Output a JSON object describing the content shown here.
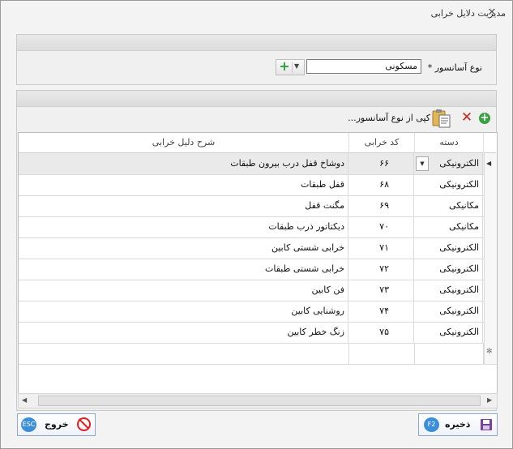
{
  "window": {
    "title": "مدیریت دلایل خرابی",
    "close_glyph": "✕"
  },
  "filter": {
    "label": "نوع آسانسور *",
    "selected_value": "مسکونی"
  },
  "toolbar": {
    "copy_label": "کپی از نوع آسانسور..."
  },
  "grid": {
    "columns": {
      "category": "دسته",
      "code": "کد خرابی",
      "description": "شرح دلیل خرابی"
    },
    "rows": [
      {
        "category": "الکترونیکی",
        "code": "۶۶",
        "description": "دوشاخ قفل درب بیرون طبقات"
      },
      {
        "category": "الکترونیکی",
        "code": "۶۸",
        "description": "قفل طبقات"
      },
      {
        "category": "مکانیکی",
        "code": "۶۹",
        "description": "مگنت قفل"
      },
      {
        "category": "مکانیکی",
        "code": "۷۰",
        "description": "دیکتاتور ذرب طبقات"
      },
      {
        "category": "الکترونیکی",
        "code": "۷۱",
        "description": "خرابی شستی کابین"
      },
      {
        "category": "الکترونیکی",
        "code": "۷۲",
        "description": "خرابی شستی طبقات"
      },
      {
        "category": "الکترونیکی",
        "code": "۷۳",
        "description": "فن کابین"
      },
      {
        "category": "الکترونیکی",
        "code": "۷۴",
        "description": "روشنایی کابین"
      },
      {
        "category": "الکترونیکی",
        "code": "۷۵",
        "description": "زنگ خطر کابین"
      }
    ],
    "new_row_glyph": "✻"
  },
  "footer": {
    "save_label": "ذخیره",
    "save_key": "F2",
    "exit_label": "خروج",
    "exit_key": "ESC"
  },
  "colors": {
    "accent": "#3b8fd9",
    "add_green": "#3aa045",
    "delete_red": "#d21f1f",
    "save_purple": "#7b3fa0",
    "exit_red": "#e02020"
  }
}
